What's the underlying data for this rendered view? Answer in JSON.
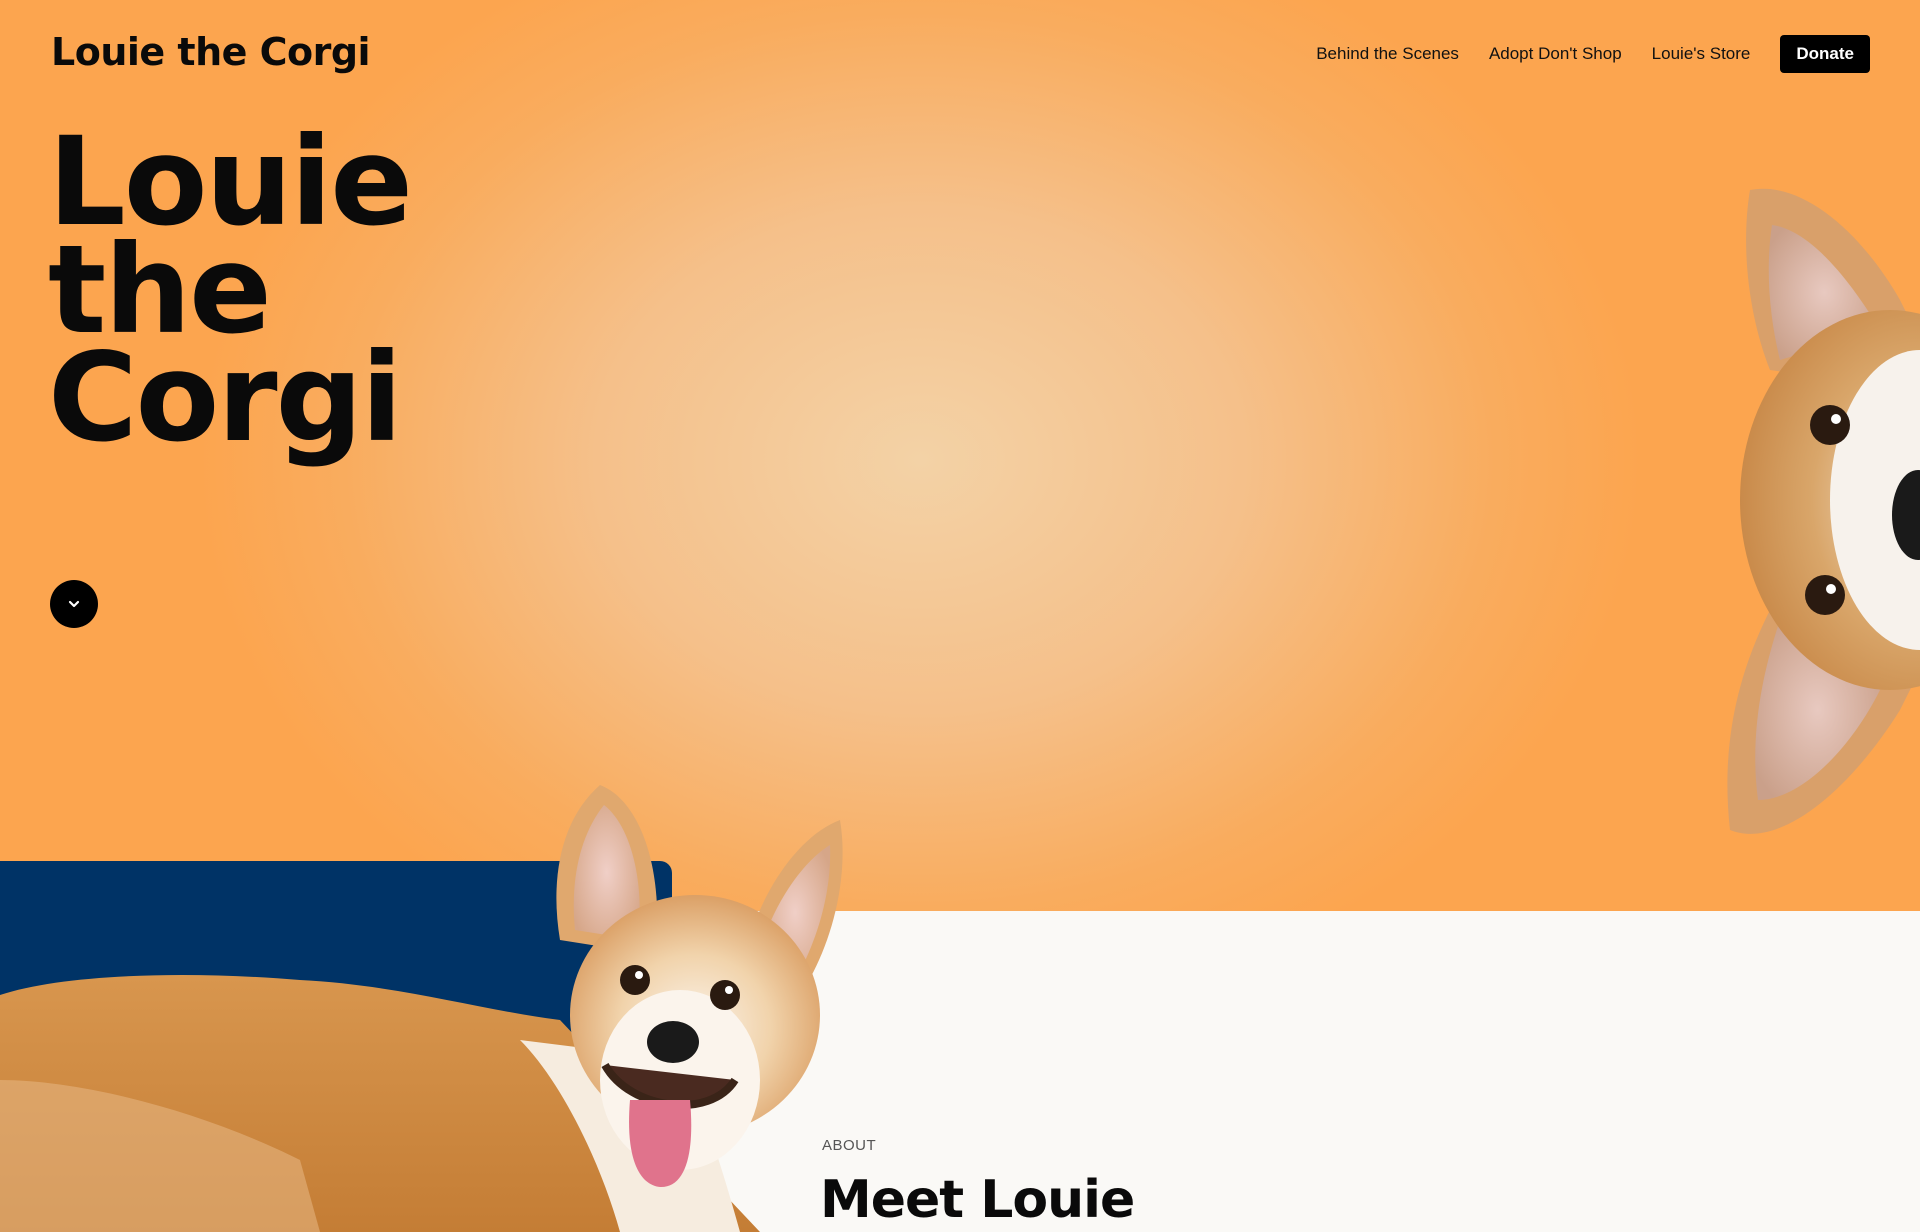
{
  "header": {
    "logo": "Louie the Corgi",
    "nav": [
      {
        "label": "Behind the Scenes"
      },
      {
        "label": "Adopt Don't Shop"
      },
      {
        "label": "Louie's Store"
      }
    ],
    "donate_label": "Donate"
  },
  "hero": {
    "title_lines": [
      "Louie",
      "the",
      "Corgi"
    ],
    "scroll_icon": "chevron-down-icon"
  },
  "about": {
    "label": "ABOUT",
    "title": "Meet Louie"
  },
  "colors": {
    "hero_orange": "#fca54f",
    "hero_center": "#f3d2a6",
    "blue_card": "#003366",
    "page_bg": "#faf9f6",
    "text": "#0a0a0a"
  }
}
